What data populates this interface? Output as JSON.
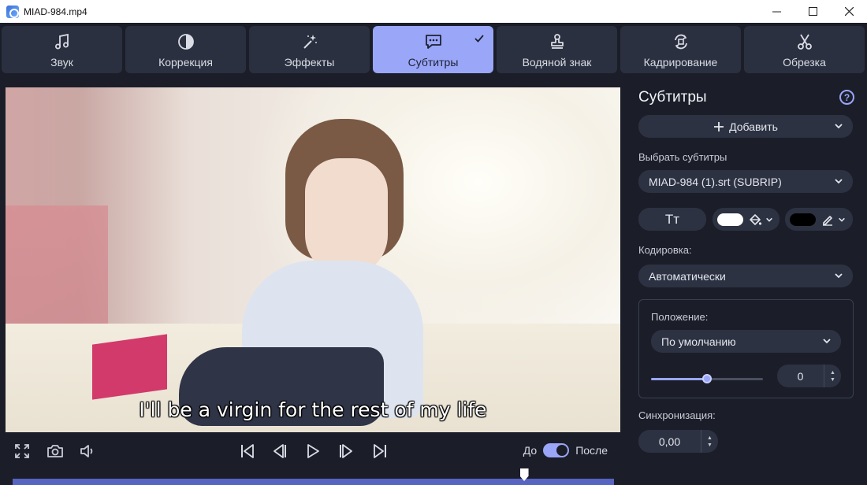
{
  "window": {
    "title": "MIAD-984.mp4",
    "minimize": "—",
    "maximize": "☐",
    "close": "✕"
  },
  "tabs": [
    {
      "label": "Звук",
      "icon": "music-note-icon",
      "active": false
    },
    {
      "label": "Коррекция",
      "icon": "contrast-icon",
      "active": false
    },
    {
      "label": "Эффекты",
      "icon": "magic-wand-icon",
      "active": false
    },
    {
      "label": "Субтитры",
      "icon": "speech-bubble-icon",
      "active": true
    },
    {
      "label": "Водяной знак",
      "icon": "stamp-icon",
      "active": false
    },
    {
      "label": "Кадрирование",
      "icon": "rotate-crop-icon",
      "active": false
    },
    {
      "label": "Обрезка",
      "icon": "scissors-icon",
      "active": false
    }
  ],
  "video": {
    "subtitle": "I'll be a virgin for the rest of my life"
  },
  "player": {
    "compare_before": "До",
    "compare_after": "После",
    "compare_on": true,
    "position": 0.85
  },
  "panel": {
    "title": "Субтитры",
    "help": "?",
    "add_label": "Добавить",
    "choose_label": "Выбрать субтитры",
    "selected_file": "MIAD-984 (1).srt (SUBRIP)",
    "font_button": "Tт",
    "text_color": "#ffffff",
    "outline_color": "#000000",
    "encoding_label": "Кодировка:",
    "encoding_value": "Автоматически",
    "position_label": "Положение:",
    "position_value": "По умолчанию",
    "position_slider": 0.5,
    "position_offset": "0",
    "sync_label": "Синхронизация:",
    "sync_value": "0,00"
  },
  "colors": {
    "accent": "#9aa6f8",
    "panel_bg": "#1b1e29",
    "control_bg": "#2d3242"
  }
}
